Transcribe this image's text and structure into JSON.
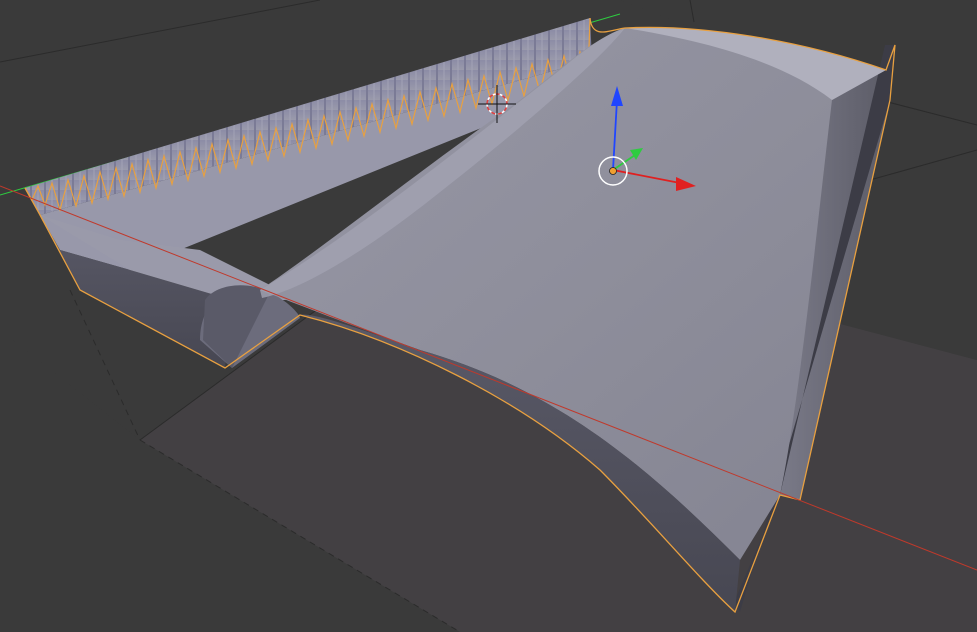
{
  "viewport": {
    "background_color": "#3a3a3a",
    "grid_floor_color": "#434043",
    "grid_line_color": "#2f2f2f",
    "selection_outline_color": "#e8a040",
    "mesh_color": "#8a8a98"
  },
  "axes": {
    "x_axis_color": "#c0392b",
    "y_axis_color": "#2ecc40",
    "z_axis_color": "#2046ff"
  },
  "widgets": {
    "cursor_icon": "3d-cursor-icon",
    "origin_icon": "object-origin-icon",
    "manipulator_icon": "transform-manipulator-icon"
  }
}
